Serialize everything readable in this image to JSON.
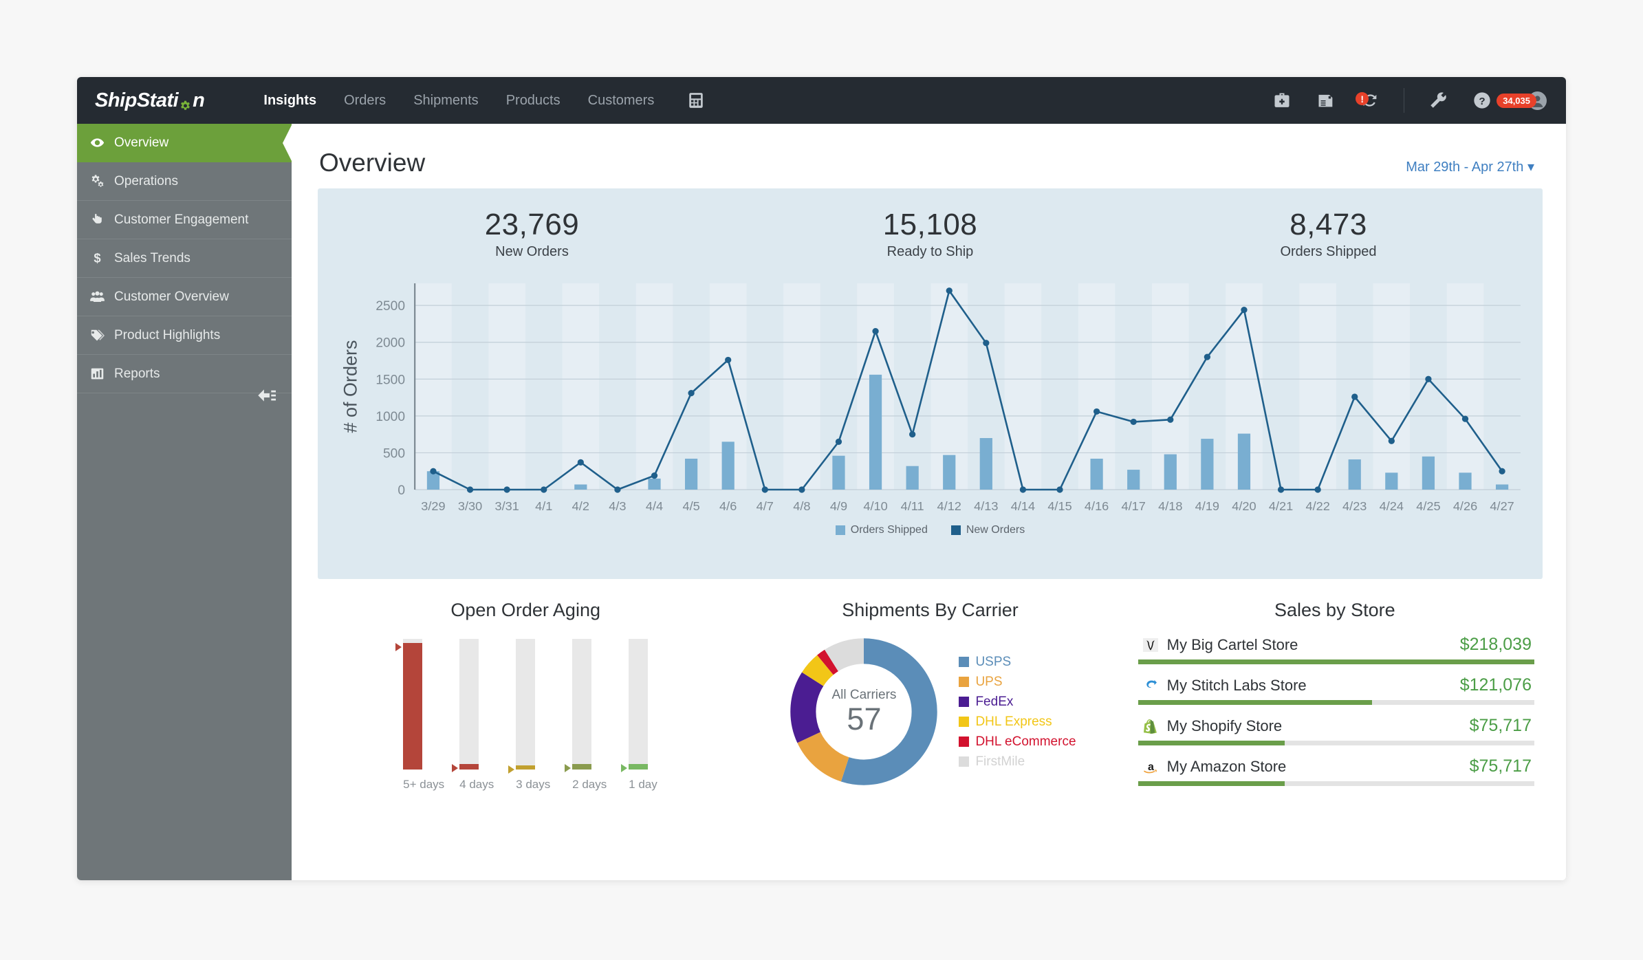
{
  "brand": {
    "name_part1": "ShipStati",
    "name_part2": "n",
    "gear_icon": "gear-icon",
    "accent": "#79b338"
  },
  "topnav": {
    "links": [
      {
        "label": "Insights",
        "active": true
      },
      {
        "label": "Orders",
        "active": false
      },
      {
        "label": "Shipments",
        "active": false
      },
      {
        "label": "Products",
        "active": false
      },
      {
        "label": "Customers",
        "active": false
      }
    ],
    "calculator_icon": "calculator-icon",
    "right_icons": [
      {
        "name": "medical-kit-icon"
      },
      {
        "name": "printer-label-icon"
      },
      {
        "name": "refresh-alert-icon",
        "alert": "!"
      },
      {
        "name": "wrench-icon"
      }
    ],
    "help_icon": "help-icon",
    "notification_count": "34,035",
    "avatar_icon": "user-avatar-icon",
    "bg": "#252b32"
  },
  "sidebar": {
    "items": [
      {
        "label": "Overview",
        "icon": "eye-icon",
        "active": true
      },
      {
        "label": "Operations",
        "icon": "gears-icon",
        "active": false
      },
      {
        "label": "Customer Engagement",
        "icon": "hand-pointer-icon",
        "active": false
      },
      {
        "label": "Sales Trends",
        "icon": "dollar-icon",
        "active": false
      },
      {
        "label": "Customer Overview",
        "icon": "users-icon",
        "active": false
      },
      {
        "label": "Product Highlights",
        "icon": "tag-icon",
        "active": false
      },
      {
        "label": "Reports",
        "icon": "bar-chart-icon",
        "active": false
      }
    ],
    "collapse_icon": "collapse-sidebar-icon",
    "bg": "#6f7679",
    "active_bg": "#6ca03b"
  },
  "page": {
    "title": "Overview",
    "date_range": "Mar 29th - Apr 27th",
    "date_caret": "▾",
    "date_color": "#3f7fc1"
  },
  "kpis": [
    {
      "value": "23,769",
      "label": "New Orders"
    },
    {
      "value": "15,108",
      "label": "Ready to Ship"
    },
    {
      "value": "8,473",
      "label": "Orders Shipped"
    }
  ],
  "chart_data": {
    "type": "line",
    "title": "",
    "xlabel": "",
    "ylabel": "# of Orders",
    "ylim": [
      0,
      2800
    ],
    "yticks": [
      0,
      500,
      1000,
      1500,
      2000,
      2500
    ],
    "grid": true,
    "legend_position": "bottom",
    "bar_color": "#79aed1",
    "line_color": "#1f5f8b",
    "panel_bg": "#dde9f0",
    "categories": [
      "3/29",
      "3/30",
      "3/31",
      "4/1",
      "4/2",
      "4/3",
      "4/4",
      "4/5",
      "4/6",
      "4/7",
      "4/8",
      "4/9",
      "4/10",
      "4/11",
      "4/12",
      "4/13",
      "4/14",
      "4/15",
      "4/16",
      "4/17",
      "4/18",
      "4/19",
      "4/20",
      "4/21",
      "4/22",
      "4/23",
      "4/24",
      "4/25",
      "4/26",
      "4/27"
    ],
    "series": [
      {
        "name": "Orders Shipped",
        "type": "bar",
        "color": "#79aed1",
        "values": [
          250,
          0,
          0,
          0,
          70,
          0,
          150,
          420,
          650,
          0,
          0,
          460,
          1560,
          320,
          470,
          700,
          0,
          0,
          420,
          270,
          480,
          690,
          760,
          0,
          0,
          410,
          230,
          450,
          230,
          70
        ]
      },
      {
        "name": "New Orders",
        "type": "line",
        "color": "#1f5f8b",
        "values": [
          250,
          0,
          0,
          0,
          370,
          0,
          190,
          1310,
          1760,
          0,
          0,
          650,
          2150,
          750,
          2700,
          1990,
          0,
          0,
          1060,
          920,
          950,
          1800,
          2440,
          0,
          0,
          1260,
          660,
          1500,
          960,
          250
        ]
      }
    ]
  },
  "aging": {
    "title": "Open Order Aging",
    "bars": [
      {
        "label": "5+ days",
        "pct": 97,
        "color": "#b4453a"
      },
      {
        "label": "4 days",
        "pct": 4,
        "color": "#b4453a"
      },
      {
        "label": "3 days",
        "pct": 3,
        "color": "#c1a02f"
      },
      {
        "label": "2 days",
        "pct": 4,
        "color": "#8a9b4e"
      },
      {
        "label": "1 day",
        "pct": 4,
        "color": "#78b862"
      }
    ],
    "track_color": "#e8e8e8"
  },
  "carrier": {
    "title": "Shipments By Carrier",
    "center_label": "All Carriers",
    "center_value": "57",
    "chart_data": {
      "type": "pie",
      "title": "Shipments By Carrier",
      "labels": [
        "USPS",
        "UPS",
        "FedEx",
        "DHL Express",
        "DHL eCommerce",
        "FirstMile"
      ],
      "values": [
        55,
        13,
        16,
        5,
        2,
        9
      ],
      "colors": [
        "#5b8db8",
        "#e9a33f",
        "#4b1d92",
        "#f2c617",
        "#d2122e",
        "#dcdcdc"
      ]
    },
    "legend": [
      {
        "label": "USPS",
        "color": "#5b8db8"
      },
      {
        "label": "UPS",
        "color": "#e9a33f"
      },
      {
        "label": "FedEx",
        "color": "#4b1d92"
      },
      {
        "label": "DHL Express",
        "color": "#f2c617"
      },
      {
        "label": "DHL eCommerce",
        "color": "#d2122e"
      },
      {
        "label": "FirstMile",
        "color": "#dcdcdc"
      }
    ]
  },
  "stores": {
    "title": "Sales by Store",
    "items": [
      {
        "name": "My Big Cartel Store",
        "amount": "$218,039",
        "pct": 100,
        "icon": "big-cartel-icon"
      },
      {
        "name": "My Stitch Labs Store",
        "amount": "$121,076",
        "pct": 59,
        "icon": "stitch-labs-icon"
      },
      {
        "name": "My Shopify Store",
        "amount": "$75,717",
        "pct": 37,
        "icon": "shopify-icon"
      },
      {
        "name": "My Amazon Store",
        "amount": "$75,717",
        "pct": 37,
        "icon": "amazon-icon"
      }
    ],
    "bar_color": "#6a9e4a",
    "amount_color": "#4b9d46"
  }
}
